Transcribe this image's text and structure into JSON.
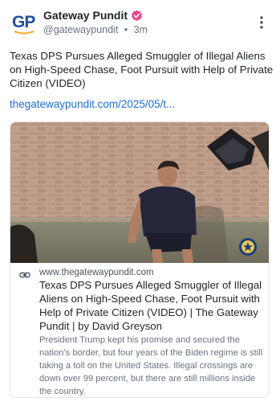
{
  "account": {
    "name": "Gateway Pundit",
    "handle": "@gatewaypundit",
    "separator": "•",
    "age": "3m",
    "avatar_text": "GP",
    "verified_icon": "verified-badge-icon",
    "brand_color": "#1f4f9c",
    "verified_color": "#e9468f"
  },
  "post": {
    "text": "Texas DPS Pursues Alleged Smuggler of Illegal Aliens on High-Speed Chase, Foot Pursuit with Help of Private Citizen (VIDEO)",
    "link": "thegatewaypundit.com/2025/05/t...",
    "link_color": "#1d6fd8"
  },
  "card": {
    "domain": "www.thegatewaypundit.com",
    "title": "Texas DPS Pursues Alleged Smuggler of Illegal Aliens on High-Speed Chase, Foot Pursuit with Help of Private Citizen (VIDEO) | The Gateway Pundit | by David Greyson",
    "description": "President Trump kept his promise and secured the nation's border, but four years of the Biden regime is still taking a toll on the United States. Illegal crossings are down over 99 percent, but there are still millions inside the country.",
    "link_icon": "link-icon"
  }
}
